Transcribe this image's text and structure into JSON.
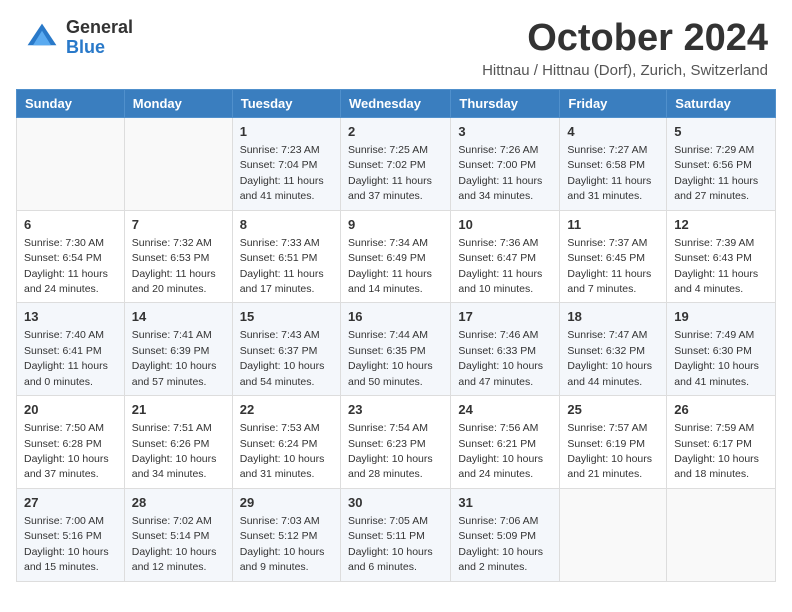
{
  "header": {
    "logo_general": "General",
    "logo_blue": "Blue",
    "month_title": "October 2024",
    "location": "Hittnau / Hittnau (Dorf), Zurich, Switzerland"
  },
  "days_of_week": [
    "Sunday",
    "Monday",
    "Tuesday",
    "Wednesday",
    "Thursday",
    "Friday",
    "Saturday"
  ],
  "weeks": [
    [
      {
        "day": "",
        "info": ""
      },
      {
        "day": "",
        "info": ""
      },
      {
        "day": "1",
        "info": "Sunrise: 7:23 AM\nSunset: 7:04 PM\nDaylight: 11 hours and 41 minutes."
      },
      {
        "day": "2",
        "info": "Sunrise: 7:25 AM\nSunset: 7:02 PM\nDaylight: 11 hours and 37 minutes."
      },
      {
        "day": "3",
        "info": "Sunrise: 7:26 AM\nSunset: 7:00 PM\nDaylight: 11 hours and 34 minutes."
      },
      {
        "day": "4",
        "info": "Sunrise: 7:27 AM\nSunset: 6:58 PM\nDaylight: 11 hours and 31 minutes."
      },
      {
        "day": "5",
        "info": "Sunrise: 7:29 AM\nSunset: 6:56 PM\nDaylight: 11 hours and 27 minutes."
      }
    ],
    [
      {
        "day": "6",
        "info": "Sunrise: 7:30 AM\nSunset: 6:54 PM\nDaylight: 11 hours and 24 minutes."
      },
      {
        "day": "7",
        "info": "Sunrise: 7:32 AM\nSunset: 6:53 PM\nDaylight: 11 hours and 20 minutes."
      },
      {
        "day": "8",
        "info": "Sunrise: 7:33 AM\nSunset: 6:51 PM\nDaylight: 11 hours and 17 minutes."
      },
      {
        "day": "9",
        "info": "Sunrise: 7:34 AM\nSunset: 6:49 PM\nDaylight: 11 hours and 14 minutes."
      },
      {
        "day": "10",
        "info": "Sunrise: 7:36 AM\nSunset: 6:47 PM\nDaylight: 11 hours and 10 minutes."
      },
      {
        "day": "11",
        "info": "Sunrise: 7:37 AM\nSunset: 6:45 PM\nDaylight: 11 hours and 7 minutes."
      },
      {
        "day": "12",
        "info": "Sunrise: 7:39 AM\nSunset: 6:43 PM\nDaylight: 11 hours and 4 minutes."
      }
    ],
    [
      {
        "day": "13",
        "info": "Sunrise: 7:40 AM\nSunset: 6:41 PM\nDaylight: 11 hours and 0 minutes."
      },
      {
        "day": "14",
        "info": "Sunrise: 7:41 AM\nSunset: 6:39 PM\nDaylight: 10 hours and 57 minutes."
      },
      {
        "day": "15",
        "info": "Sunrise: 7:43 AM\nSunset: 6:37 PM\nDaylight: 10 hours and 54 minutes."
      },
      {
        "day": "16",
        "info": "Sunrise: 7:44 AM\nSunset: 6:35 PM\nDaylight: 10 hours and 50 minutes."
      },
      {
        "day": "17",
        "info": "Sunrise: 7:46 AM\nSunset: 6:33 PM\nDaylight: 10 hours and 47 minutes."
      },
      {
        "day": "18",
        "info": "Sunrise: 7:47 AM\nSunset: 6:32 PM\nDaylight: 10 hours and 44 minutes."
      },
      {
        "day": "19",
        "info": "Sunrise: 7:49 AM\nSunset: 6:30 PM\nDaylight: 10 hours and 41 minutes."
      }
    ],
    [
      {
        "day": "20",
        "info": "Sunrise: 7:50 AM\nSunset: 6:28 PM\nDaylight: 10 hours and 37 minutes."
      },
      {
        "day": "21",
        "info": "Sunrise: 7:51 AM\nSunset: 6:26 PM\nDaylight: 10 hours and 34 minutes."
      },
      {
        "day": "22",
        "info": "Sunrise: 7:53 AM\nSunset: 6:24 PM\nDaylight: 10 hours and 31 minutes."
      },
      {
        "day": "23",
        "info": "Sunrise: 7:54 AM\nSunset: 6:23 PM\nDaylight: 10 hours and 28 minutes."
      },
      {
        "day": "24",
        "info": "Sunrise: 7:56 AM\nSunset: 6:21 PM\nDaylight: 10 hours and 24 minutes."
      },
      {
        "day": "25",
        "info": "Sunrise: 7:57 AM\nSunset: 6:19 PM\nDaylight: 10 hours and 21 minutes."
      },
      {
        "day": "26",
        "info": "Sunrise: 7:59 AM\nSunset: 6:17 PM\nDaylight: 10 hours and 18 minutes."
      }
    ],
    [
      {
        "day": "27",
        "info": "Sunrise: 7:00 AM\nSunset: 5:16 PM\nDaylight: 10 hours and 15 minutes."
      },
      {
        "day": "28",
        "info": "Sunrise: 7:02 AM\nSunset: 5:14 PM\nDaylight: 10 hours and 12 minutes."
      },
      {
        "day": "29",
        "info": "Sunrise: 7:03 AM\nSunset: 5:12 PM\nDaylight: 10 hours and 9 minutes."
      },
      {
        "day": "30",
        "info": "Sunrise: 7:05 AM\nSunset: 5:11 PM\nDaylight: 10 hours and 6 minutes."
      },
      {
        "day": "31",
        "info": "Sunrise: 7:06 AM\nSunset: 5:09 PM\nDaylight: 10 hours and 2 minutes."
      },
      {
        "day": "",
        "info": ""
      },
      {
        "day": "",
        "info": ""
      }
    ]
  ]
}
